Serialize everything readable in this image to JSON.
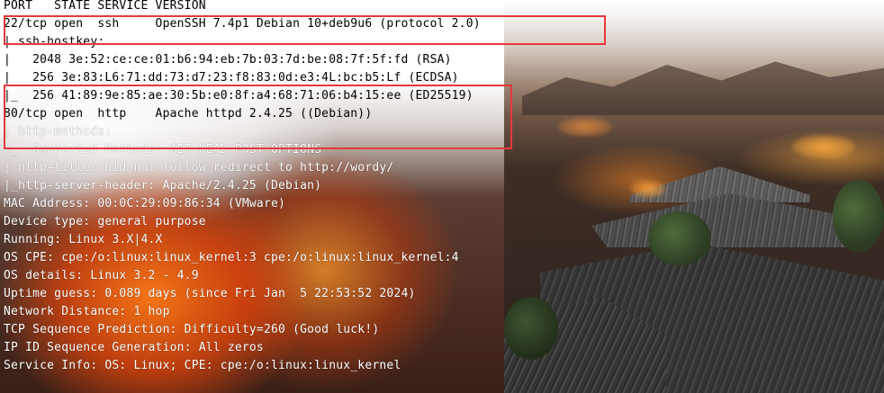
{
  "colors": {
    "highlight_box": "#e8383a",
    "text_light": "#ffffff",
    "text_dark": "#000000"
  },
  "terminal": {
    "lines": [
      "PORT   STATE SERVICE VERSION",
      "22/tcp open  ssh     OpenSSH 7.4p1 Debian 10+deb9u6 (protocol 2.0)",
      "| ssh-hostkey:",
      "|   2048 3e:52:ce:ce:01:b6:94:eb:7b:03:7d:be:08:7f:5f:fd (RSA)",
      "|   256 3e:83:L6:71:dd:73:d7:23:f8:83:0d:e3:4L:bc:b5:Lf (ECDSA)",
      "|_  256 41:89:9e:85:ae:30:5b:e0:8f:a4:68:71:06:b4:15:ee (ED25519)",
      "80/tcp open  http    Apache httpd 2.4.25 ((Debian))",
      "| http-methods:",
      "|_  Supported Methods: GET HEAD POST OPTIONS",
      "|_http-title: Did not follow redirect to http://wordy/",
      "|_http-server-header: Apache/2.4.25 (Debian)",
      "MAC Address: 00:0C:29:09:86:34 (VMware)",
      "Device type: general purpose",
      "Running: Linux 3.X|4.X",
      "OS CPE: cpe:/o:linux:linux_kernel:3 cpe:/o:linux:linux_kernel:4",
      "OS details: Linux 3.2 - 4.9",
      "Uptime guess: 0.089 days (since Fri Jan  5 22:53:52 2024)",
      "Network Distance: 1 hop",
      "TCP Sequence Prediction: Difficulty=260 (Good luck!)",
      "IP ID Sequence Generation: All zeros",
      "Service Info: OS: Linux; CPE: cpe:/o:linux:linux_kernel"
    ]
  }
}
